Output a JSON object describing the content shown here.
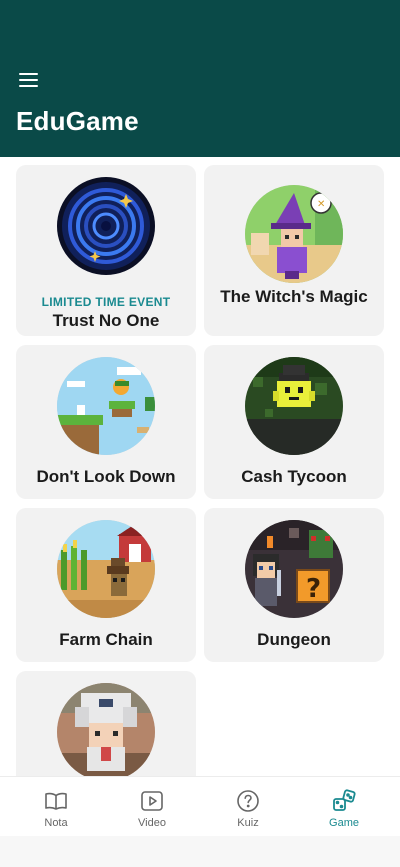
{
  "app": {
    "title": "EduGame",
    "menu_icon": "hamburger-menu-icon",
    "accent": "#0a4a48"
  },
  "games": [
    {
      "title": "Trust No One",
      "badge": "LIMITED TIME EVENT",
      "thumb": "blue-vortex-portal"
    },
    {
      "title": "The Witch's Magic",
      "thumb": "pixel-witch"
    },
    {
      "title": "Don't Look Down",
      "thumb": "pixel-cliff-platformer"
    },
    {
      "title": "Cash Tycoon",
      "thumb": "pixel-green-blob-in-jungle"
    },
    {
      "title": "Farm Chain",
      "thumb": "pixel-farm-scarecrow"
    },
    {
      "title": "Dungeon",
      "thumb": "pixel-dungeon-knight-and-mystery-box"
    },
    {
      "title": "",
      "thumb": "pixel-chef-character"
    }
  ],
  "nav": {
    "items": [
      {
        "label": "Nota",
        "icon": "open-book-icon"
      },
      {
        "label": "Video",
        "icon": "play-video-icon"
      },
      {
        "label": "Kuiz",
        "icon": "question-circle-icon"
      },
      {
        "label": "Game",
        "icon": "dice-game-icon",
        "active": true
      }
    ],
    "active_color": "#1a8a90"
  }
}
